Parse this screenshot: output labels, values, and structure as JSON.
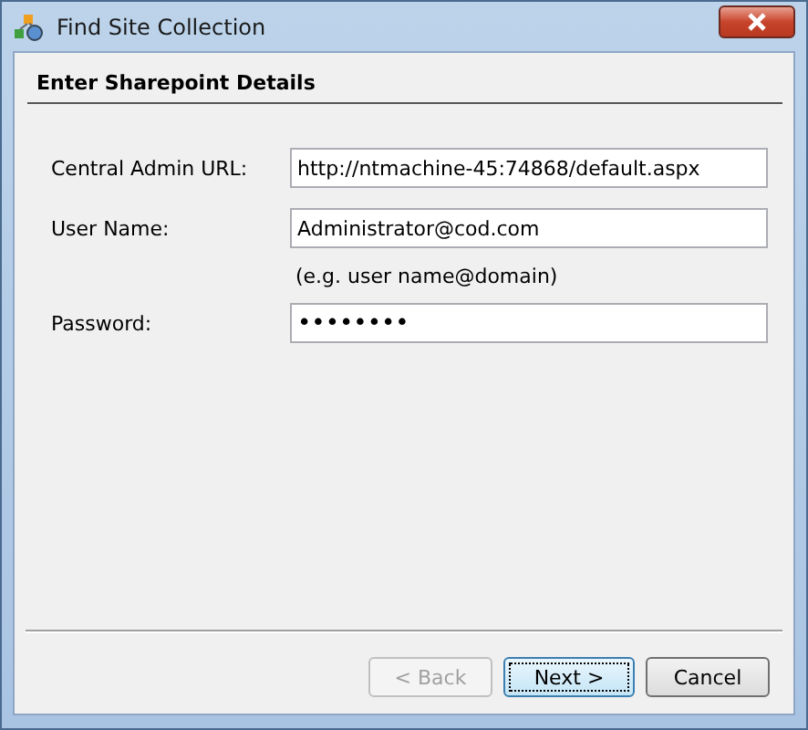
{
  "window": {
    "title": "Find Site Collection"
  },
  "section_title": "Enter Sharepoint Details",
  "fields": [
    {
      "kind": "text",
      "label": "Central Admin URL:",
      "value": "http://ntmachine-45:74868/default.aspx"
    },
    {
      "kind": "text",
      "label": "User Name:",
      "value": "Administrator@cod.com"
    },
    {
      "kind": "hint",
      "label": "(e.g. user name@domain)"
    },
    {
      "kind": "password",
      "label": "Password:",
      "value": "••••••••"
    }
  ],
  "buttons": [
    {
      "label": "< Back",
      "disabled": true,
      "focused": false
    },
    {
      "label": "Next >",
      "disabled": false,
      "focused": true
    },
    {
      "label": "Cancel",
      "disabled": false,
      "focused": false
    }
  ]
}
